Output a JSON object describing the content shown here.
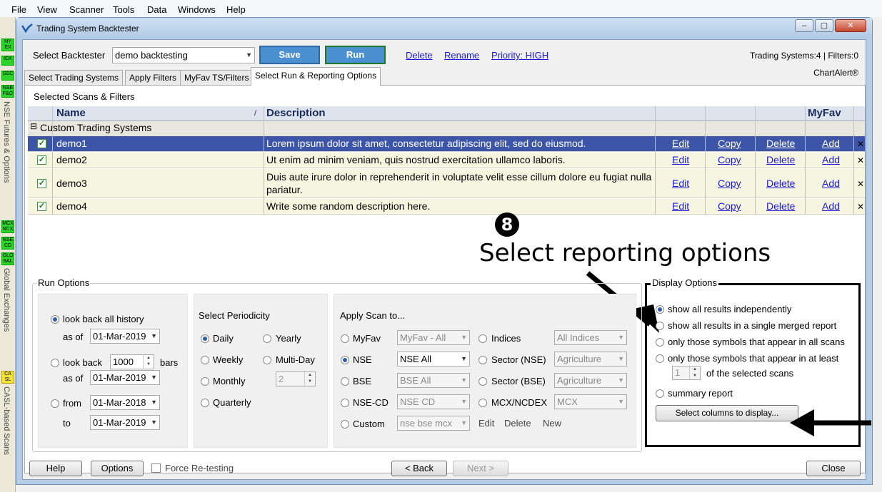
{
  "menu": [
    "File",
    "View",
    "Scanner",
    "Tools",
    "Data",
    "Windows",
    "Help"
  ],
  "exchanges_left": [
    {
      "label": "NY\nEX",
      "name": "nyex"
    },
    {
      "label": "IDX",
      "name": "idx"
    },
    {
      "label": "SEC",
      "name": "sec"
    },
    {
      "label": "NSE\nF&O",
      "name": "nse-fo"
    },
    {
      "label": "MCX\nNCX",
      "name": "mcx"
    },
    {
      "label": "NSE\nCD",
      "name": "nse-cd"
    },
    {
      "label": "GLO\nBAL",
      "name": "global"
    },
    {
      "label": "CA\nSL",
      "name": "casl"
    }
  ],
  "left_vertical": {
    "nse_fno": "NSE Futures & Options",
    "global": "Global Exchanges",
    "casl": "CASL-based Scans"
  },
  "window": {
    "title": "Trading System Backtester",
    "minimize": "–",
    "maximize": "▢",
    "close": "✕"
  },
  "toolbar": {
    "select_label": "Select Backtester",
    "backtester_value": "demo backtesting",
    "save": "Save",
    "run": "Run",
    "delete": "Delete",
    "rename": "Rename",
    "priority": "Priority: HIGH",
    "status": "Trading Systems:4 | Filters:0",
    "brand": "ChartAlert®"
  },
  "tabs": [
    "Select Trading Systems",
    "Apply Filters",
    "MyFav TS/Filters",
    "Select Run & Reporting Options"
  ],
  "grid": {
    "section_title": "Selected Scans & Filters",
    "headers": {
      "name": "Name",
      "sort": "/",
      "description": "Description",
      "myfav": "MyFav"
    },
    "group": "Custom Trading Systems",
    "group_toggle": "⊟",
    "rows": [
      {
        "name": "demo1",
        "description": "Lorem ipsum dolor sit amet, consectetur adipiscing elit, sed do eiusmod.",
        "edit": "Edit",
        "copy": "Copy",
        "delete": "Delete",
        "add": "Add",
        "x": "✕"
      },
      {
        "name": "demo2",
        "description": "Ut enim ad minim veniam, quis nostrud exercitation ullamco laboris.",
        "edit": "Edit",
        "copy": "Copy",
        "delete": "Delete",
        "add": "Add",
        "x": "✕"
      },
      {
        "name": "demo3",
        "description": "Duis aute irure dolor in reprehenderit in voluptate velit esse cillum dolore eu fugiat nulla pariatur.",
        "edit": "Edit",
        "copy": "Copy",
        "delete": "Delete",
        "add": "Add",
        "x": "✕"
      },
      {
        "name": "demo4",
        "description": "Write some random description here.",
        "edit": "Edit",
        "copy": "Copy",
        "delete": "Delete",
        "add": "Add",
        "x": "✕"
      }
    ]
  },
  "annotation": {
    "step": "8",
    "text": "Select reporting options"
  },
  "run_options": {
    "legend": "Run Options",
    "lookback_all": "look back all history",
    "as_of": "as of",
    "date1": "01-Mar-2019",
    "lookback": "look back",
    "bars_value": "1000",
    "bars": "bars",
    "date2": "01-Mar-2019",
    "from": "from",
    "date3": "01-Mar-2018",
    "to": "to",
    "date4": "01-Mar-2019"
  },
  "periodicity": {
    "title": "Select Periodicity",
    "daily": "Daily",
    "weekly": "Weekly",
    "monthly": "Monthly",
    "quarterly": "Quarterly",
    "yearly": "Yearly",
    "multiday": "Multi-Day",
    "multiday_value": "2"
  },
  "apply_scan": {
    "title": "Apply Scan to...",
    "myfav": "MyFav",
    "myfav_value": "MyFav - All",
    "nse": "NSE",
    "nse_value": "NSE All",
    "bse": "BSE",
    "bse_value": "BSE All",
    "nsecd": "NSE-CD",
    "nsecd_value": "NSE CD",
    "custom": "Custom",
    "custom_value": "nse bse mcx",
    "edit": "Edit",
    "delete": "Delete",
    "new": "New",
    "indices": "Indices",
    "indices_value": "All Indices",
    "sector_nse": "Sector (NSE)",
    "sector_nse_value": "Agriculture",
    "sector_bse": "Sector (BSE)",
    "sector_bse_value": "Agriculture",
    "mcx": "MCX/NCDEX",
    "mcx_value": "MCX"
  },
  "display_options": {
    "legend": "Display Options",
    "opt1": "show all results independently",
    "opt2": "show all results in a single merged report",
    "opt3": "only those symbols that appear in all scans",
    "opt4": "only those symbols that appear in at least",
    "atleast_value": "1",
    "of_selected": "of the selected scans",
    "opt5": "summary report",
    "columns_button": "Select columns to display..."
  },
  "footer": {
    "help": "Help",
    "options": "Options",
    "force": "Force Re-testing",
    "back": "< Back",
    "next": "Next >",
    "close": "Close"
  }
}
